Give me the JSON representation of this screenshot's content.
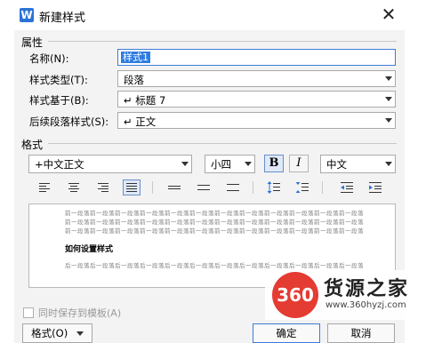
{
  "window": {
    "title": "新建样式",
    "app_icon": "W"
  },
  "properties": {
    "section_title": "属性",
    "name": {
      "label": "名称(N):",
      "value": "样式1"
    },
    "style_type": {
      "label": "样式类型(T):",
      "value": "段落"
    },
    "based_on": {
      "label": "样式基于(B):",
      "value": "↵ 标题 7"
    },
    "following": {
      "label": "后续段落样式(S):",
      "value": "↵ 正文"
    }
  },
  "format": {
    "section_title": "格式",
    "font": "+中文正文",
    "size": "小四",
    "bold": "B",
    "italic": "I",
    "language": "中文"
  },
  "preview": {
    "prev_lines": [
      "前一段落前一段落前一段落前一段落前一段落前一段落前一段落前一段落前一段落前一段落前一段落前一段落",
      "前一段落前一段落前一段落前一段落前一段落前一段落前一段落前一段落前一段落前一段落前一段落前一段落",
      "前一段落前一段落前一段落前一段落前一段落前一段落前一段落前一段落前一段落前一段落前一段落前一段落"
    ],
    "sample": "如何设置样式",
    "next_lines": [
      "后一段落后一段落后一段落后一段落后一段落后一段落后一段落后一段落后一段落后一段落后一段落后一段落"
    ]
  },
  "add_to_template": {
    "label": "同时保存到模板(A)",
    "checked": false
  },
  "buttons": {
    "format": "格式(O)",
    "ok": "确定",
    "cancel": "取消"
  },
  "watermark": {
    "badge": "360",
    "brand": "货源之家",
    "url": "www.360hyzj.com"
  },
  "colors": {
    "selection": "#2f7ce0",
    "accent_border": "#3c7ad8",
    "badge": "#e43b33"
  }
}
